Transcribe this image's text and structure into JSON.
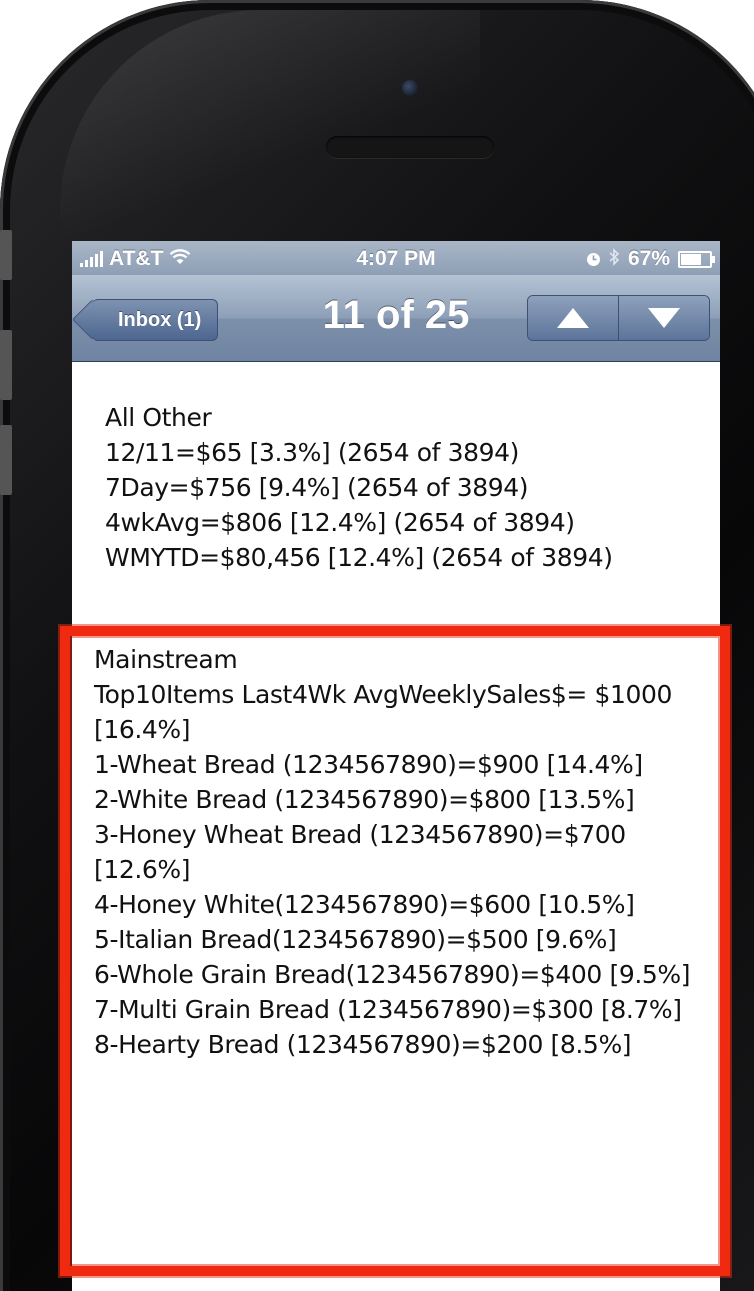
{
  "status_bar": {
    "carrier": "AT&T",
    "time": "4:07 PM",
    "battery": "67%",
    "battery_level": 0.67,
    "icons": [
      "signal-icon",
      "wifi-icon",
      "alarm-clock-icon",
      "bluetooth-icon",
      "battery-icon"
    ]
  },
  "nav": {
    "back_label": "Inbox (1)",
    "title": "11 of 25",
    "prev_icon": "arrow-up-icon",
    "next_icon": "arrow-down-icon"
  },
  "message": {
    "section1": {
      "heading": "All Other",
      "lines": [
        "12/11=$65 [3.3%] (2654 of 3894)",
        "7Day=$756 [9.4%] (2654 of 3894)",
        "4wkAvg=$806 [12.4%] (2654 of 3894)",
        "WMYTD=$80,456 [12.4%] (2654 of 3894)"
      ]
    },
    "section2": {
      "heading": "Mainstream",
      "summary": "Top10Items Last4Wk AvgWeeklySales$= $1000 [16.4%]",
      "items": [
        "1-Wheat Bread (1234567890)=$900 [14.4%]",
        "2-White Bread (1234567890)=$800 [13.5%]",
        "3-Honey Wheat Bread (1234567890)=$700 [12.6%]",
        "4-Honey White(1234567890)=$600 [10.5%]",
        "5-Italian Bread(1234567890)=$500 [9.6%]",
        "6-Whole Grain Bread(1234567890)=$400 [9.5%]",
        "7-Multi Grain Bread (1234567890)=$300 [8.7%]",
        "8-Hearty Bread (1234567890)=$200 [8.5%]"
      ]
    }
  },
  "colors": {
    "highlight": "#ef2a10",
    "nav_bar": "#8d9fb7"
  }
}
